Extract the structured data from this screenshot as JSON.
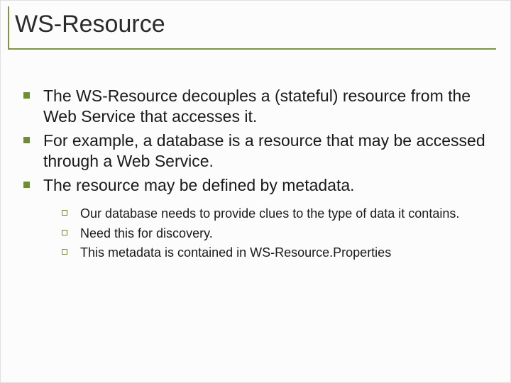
{
  "title": "WS-Resource",
  "bullets": {
    "b0": "The WS-Resource decouples a (stateful) resource from the Web Service that accesses it.",
    "b1": "For example, a database is a resource that may be accessed through a Web Service.",
    "b2": "The resource may be defined by metadata."
  },
  "subbullets": {
    "s0": "Our database needs to provide clues to the type of data it contains.",
    "s1": "Need this for discovery.",
    "s2": "This metadata is contained in WS-Resource.Properties"
  }
}
